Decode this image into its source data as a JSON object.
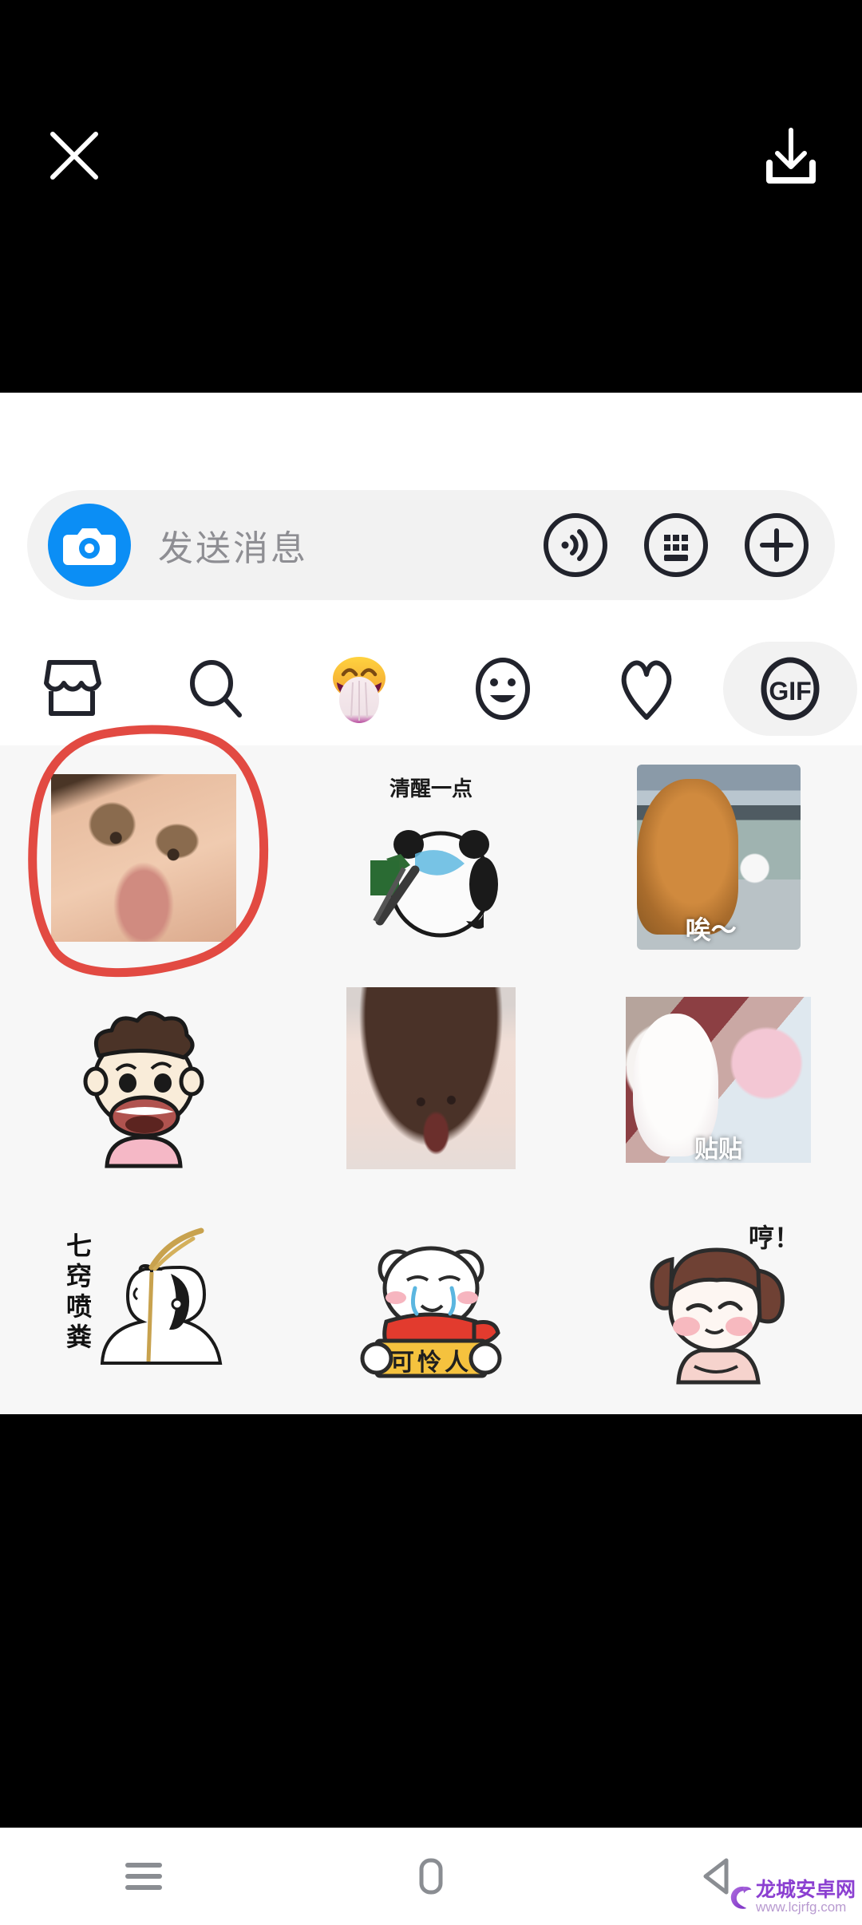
{
  "header": {
    "close_icon": "close-icon",
    "download_icon": "download-icon"
  },
  "input_bar": {
    "camera_icon": "camera-icon",
    "placeholder": "发送消息",
    "value": "",
    "voice_icon": "voice-wave-icon",
    "keyboard_icon": "keyboard-icon",
    "plus_icon": "plus-icon"
  },
  "tabs": [
    {
      "name": "store",
      "icon": "store-icon",
      "label": "",
      "selected": false
    },
    {
      "name": "search",
      "icon": "search-icon",
      "label": "",
      "selected": false
    },
    {
      "name": "emoji",
      "icon": "laughing-tongue-emoji-icon",
      "label": "",
      "selected": false
    },
    {
      "name": "sticker",
      "icon": "smiley-face-icon",
      "label": "",
      "selected": false
    },
    {
      "name": "favorites",
      "icon": "heart-icon",
      "label": "",
      "selected": false
    },
    {
      "name": "gif",
      "icon": "gif-icon",
      "label": "GIF",
      "selected": true
    }
  ],
  "stickers": [
    {
      "id": "s1",
      "kind": "photo",
      "name": "sticker-squinting-baby",
      "caption": "",
      "annotated": true
    },
    {
      "id": "s2",
      "kind": "drawn",
      "name": "sticker-panda-spray",
      "caption": "清醒一点",
      "annotated": false
    },
    {
      "id": "s3",
      "kind": "photo",
      "name": "sticker-orange-cat",
      "caption": "唉～",
      "annotated": false
    },
    {
      "id": "s4",
      "kind": "drawn",
      "name": "sticker-curly-hair-kid",
      "caption": "",
      "annotated": false
    },
    {
      "id": "s5",
      "kind": "photo",
      "name": "sticker-baby-holding-head",
      "caption": "",
      "annotated": false
    },
    {
      "id": "s6",
      "kind": "photo",
      "name": "sticker-plush-toys",
      "caption": "贴贴",
      "annotated": false
    },
    {
      "id": "s7",
      "kind": "drawn",
      "name": "sticker-line-art-figure",
      "caption": "七窍喷粪",
      "annotated": false
    },
    {
      "id": "s8",
      "kind": "drawn",
      "name": "sticker-crying-bear",
      "caption": "可怜人",
      "annotated": false
    },
    {
      "id": "s9",
      "kind": "drawn",
      "name": "sticker-pouting-girl",
      "caption": "哼！",
      "annotated": false
    }
  ],
  "annotation": {
    "shape": "hand-drawn-circle",
    "color": "#e24a42",
    "target": "sticker-squinting-baby"
  },
  "navbar": {
    "menu_icon": "menu-icon",
    "home_icon": "home-icon",
    "back_icon": "back-icon"
  },
  "watermark": {
    "site_name": "龙城安卓网",
    "url": "www.lcjrfg.com"
  },
  "colors": {
    "accent_blue": "#0b8ef5",
    "panel_bg": "#ffffff",
    "grid_bg": "#f7f7f7",
    "chip_bg": "#f2f2f2",
    "annotation_red": "#e24a42",
    "watermark_purple": "#8b3fd1"
  }
}
